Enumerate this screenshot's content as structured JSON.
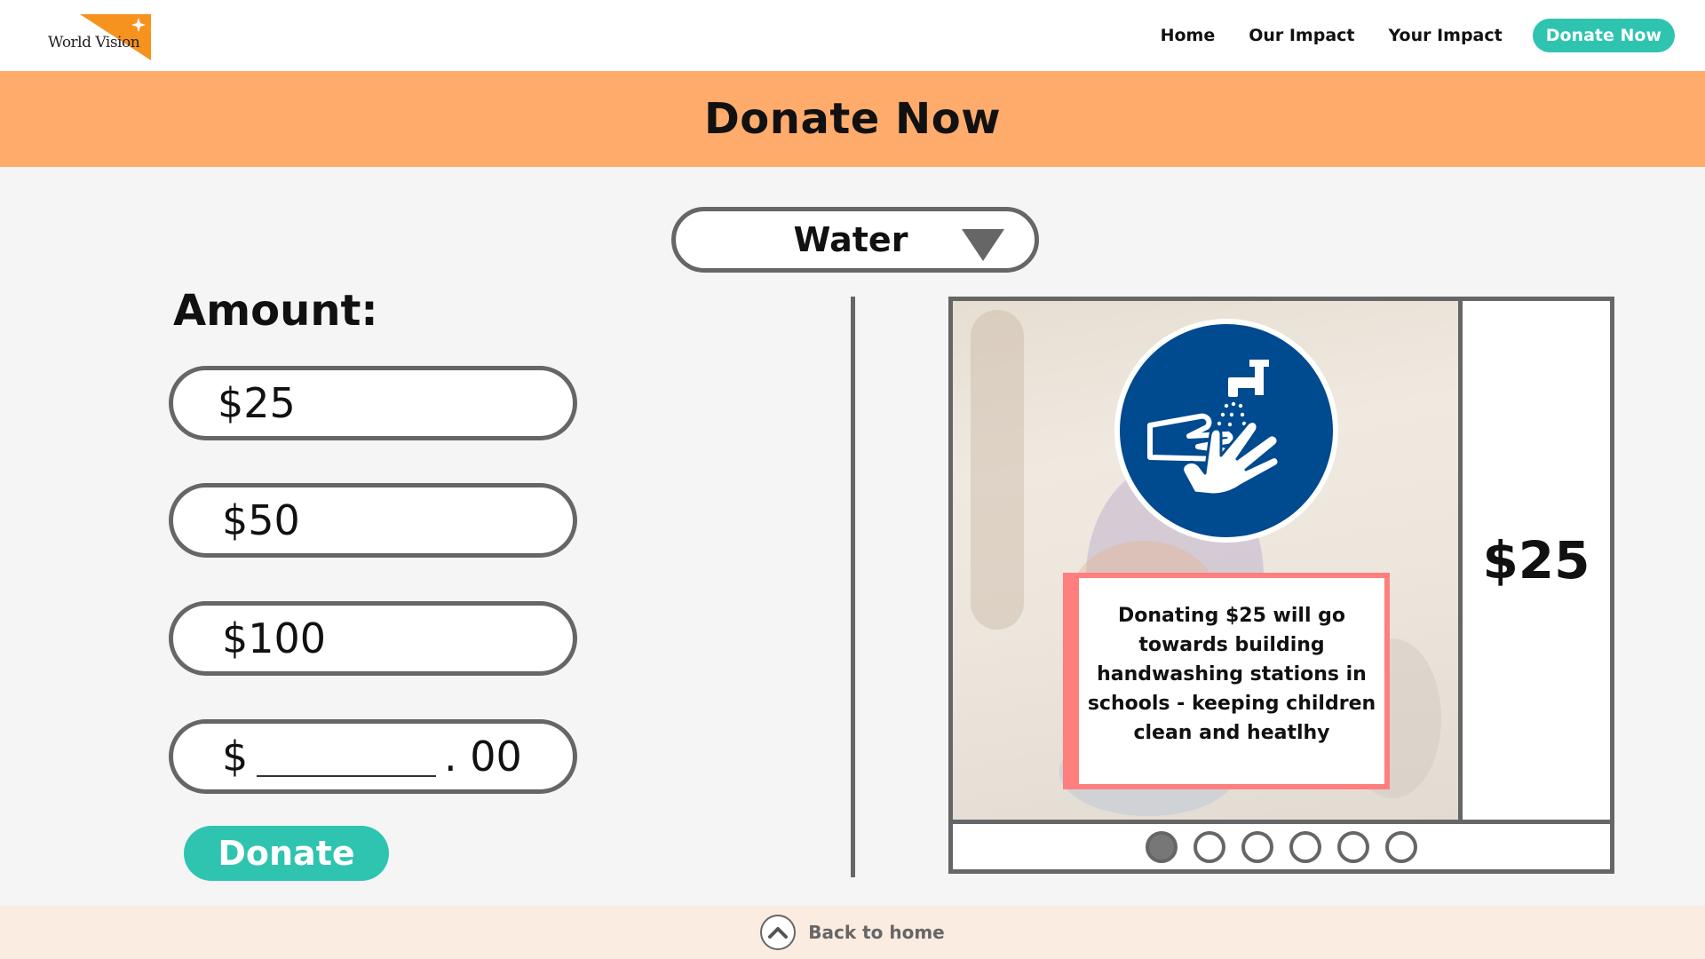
{
  "header": {
    "logo_text": "World Vision",
    "nav": [
      {
        "label": "Home"
      },
      {
        "label": "Our Impact"
      },
      {
        "label": "Your Impact"
      }
    ],
    "donate_label": "Donate Now"
  },
  "banner": {
    "title": "Donate Now"
  },
  "category": {
    "selected": "Water",
    "icon": "triangle-down-icon"
  },
  "amount": {
    "label": "Amount:",
    "options": [
      "$25",
      "$50",
      "$100"
    ],
    "custom": {
      "currency": "$",
      "cents": ". 00"
    },
    "donate_label": "Donate"
  },
  "carousel": {
    "price": "$25",
    "description": "Donating $25 will go towards building handwashing stations in schools - keeping children clean and heatlhy",
    "icon": "handwashing-icon",
    "active_slide": 1,
    "slide_count": 6
  },
  "footer": {
    "back_label": "Back to home",
    "icon": "chevron-up-icon"
  },
  "colors": {
    "accent": "#2ec4b0",
    "banner": "#ffab6b",
    "border": "#666666",
    "info_border": "#ff7f7f",
    "icon_blue": "#004a8f"
  }
}
